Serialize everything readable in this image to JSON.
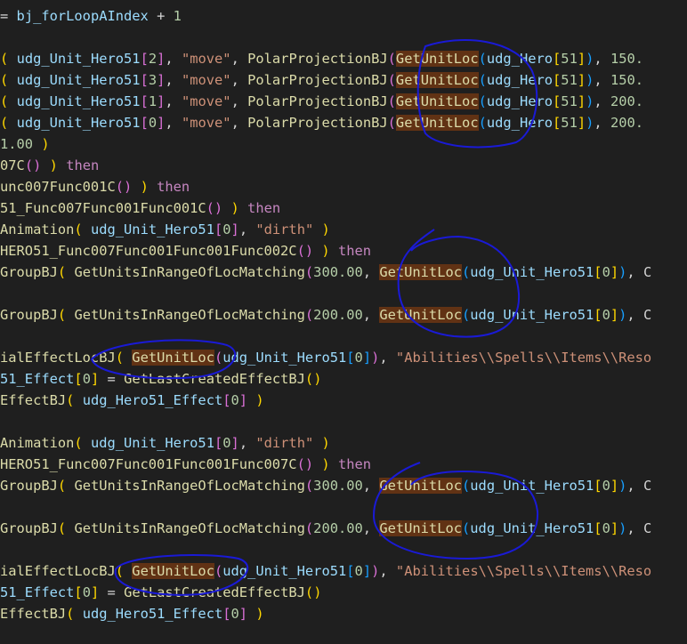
{
  "editor": {
    "colors": {
      "background": "#1f1f1f",
      "function": "#dcdcaa",
      "variable": "#9cdcfe",
      "string": "#ce9178",
      "number": "#b5cea8",
      "keyword": "#c586c0",
      "bracket_gold": "#ffd700",
      "bracket_orchid": "#da70d6",
      "bracket_blue": "#179fff",
      "highlight": "#613214",
      "annotation_ink": "#1a1ad6"
    },
    "lines": [
      [
        [
          "op",
          "= "
        ],
        [
          "var",
          "bj_forLoopAIndex"
        ],
        [
          "op",
          " + "
        ],
        [
          "num",
          "1"
        ]
      ],
      [],
      [
        [
          "br1",
          "("
        ],
        [
          "op",
          " "
        ],
        [
          "var",
          "udg_Unit_Hero51"
        ],
        [
          "br2",
          "["
        ],
        [
          "num",
          "2"
        ],
        [
          "br2",
          "]"
        ],
        [
          "op",
          ", "
        ],
        [
          "str",
          "\"move\""
        ],
        [
          "op",
          ", "
        ],
        [
          "fn",
          "PolarProjectionBJ"
        ],
        [
          "br2",
          "("
        ],
        [
          "fn",
          "GetUnitLoc",
          "hl"
        ],
        [
          "br3",
          "("
        ],
        [
          "var",
          "udg_Hero"
        ],
        [
          "br1",
          "["
        ],
        [
          "num",
          "51"
        ],
        [
          "br1",
          "]"
        ],
        [
          "br3",
          ")"
        ],
        [
          "op",
          ", "
        ],
        [
          "num",
          "150."
        ]
      ],
      [
        [
          "br1",
          "("
        ],
        [
          "op",
          " "
        ],
        [
          "var",
          "udg_Unit_Hero51"
        ],
        [
          "br2",
          "["
        ],
        [
          "num",
          "3"
        ],
        [
          "br2",
          "]"
        ],
        [
          "op",
          ", "
        ],
        [
          "str",
          "\"move\""
        ],
        [
          "op",
          ", "
        ],
        [
          "fn",
          "PolarProjectionBJ"
        ],
        [
          "br2",
          "("
        ],
        [
          "fn",
          "GetUnitLoc",
          "hl"
        ],
        [
          "br3",
          "("
        ],
        [
          "var",
          "udg_Hero"
        ],
        [
          "br1",
          "["
        ],
        [
          "num",
          "51"
        ],
        [
          "br1",
          "]"
        ],
        [
          "br3",
          ")"
        ],
        [
          "op",
          ", "
        ],
        [
          "num",
          "150."
        ]
      ],
      [
        [
          "br1",
          "("
        ],
        [
          "op",
          " "
        ],
        [
          "var",
          "udg_Unit_Hero51"
        ],
        [
          "br2",
          "["
        ],
        [
          "num",
          "1"
        ],
        [
          "br2",
          "]"
        ],
        [
          "op",
          ", "
        ],
        [
          "str",
          "\"move\""
        ],
        [
          "op",
          ", "
        ],
        [
          "fn",
          "PolarProjectionBJ"
        ],
        [
          "br2",
          "("
        ],
        [
          "fn",
          "GetUnitLoc",
          "hl"
        ],
        [
          "br3",
          "("
        ],
        [
          "var",
          "udg_Hero"
        ],
        [
          "br1",
          "["
        ],
        [
          "num",
          "51"
        ],
        [
          "br1",
          "]"
        ],
        [
          "br3",
          ")"
        ],
        [
          "op",
          ", "
        ],
        [
          "num",
          "200."
        ]
      ],
      [
        [
          "br1",
          "("
        ],
        [
          "op",
          " "
        ],
        [
          "var",
          "udg_Unit_Hero51"
        ],
        [
          "br2",
          "["
        ],
        [
          "num",
          "0"
        ],
        [
          "br2",
          "]"
        ],
        [
          "op",
          ", "
        ],
        [
          "str",
          "\"move\""
        ],
        [
          "op",
          ", "
        ],
        [
          "fn",
          "PolarProjectionBJ"
        ],
        [
          "br2",
          "("
        ],
        [
          "fn",
          "GetUnitLoc",
          "hl"
        ],
        [
          "br3",
          "("
        ],
        [
          "var",
          "udg_Hero"
        ],
        [
          "br1",
          "["
        ],
        [
          "num",
          "51"
        ],
        [
          "br1",
          "]"
        ],
        [
          "br3",
          ")"
        ],
        [
          "op",
          ", "
        ],
        [
          "num",
          "200."
        ]
      ],
      [
        [
          "num",
          "1.00"
        ],
        [
          "op",
          " "
        ],
        [
          "br1",
          ")"
        ]
      ],
      [
        [
          "fn",
          "07C"
        ],
        [
          "br2",
          "()"
        ],
        [
          "op",
          " "
        ],
        [
          "br1",
          ")"
        ],
        [
          "op",
          " "
        ],
        [
          "kw",
          "then"
        ]
      ],
      [
        [
          "fn",
          "unc007Func001C"
        ],
        [
          "br2",
          "()"
        ],
        [
          "op",
          " "
        ],
        [
          "br1",
          ")"
        ],
        [
          "op",
          " "
        ],
        [
          "kw",
          "then"
        ]
      ],
      [
        [
          "fn",
          "51_Func007Func001Func001C"
        ],
        [
          "br2",
          "()"
        ],
        [
          "op",
          " "
        ],
        [
          "br1",
          ")"
        ],
        [
          "op",
          " "
        ],
        [
          "kw",
          "then"
        ]
      ],
      [
        [
          "fn",
          "Animation"
        ],
        [
          "br1",
          "("
        ],
        [
          "op",
          " "
        ],
        [
          "var",
          "udg_Unit_Hero51"
        ],
        [
          "br2",
          "["
        ],
        [
          "num",
          "0"
        ],
        [
          "br2",
          "]"
        ],
        [
          "op",
          ", "
        ],
        [
          "str",
          "\"dirth\""
        ],
        [
          "op",
          " "
        ],
        [
          "br1",
          ")"
        ]
      ],
      [
        [
          "fn",
          "HERO51_Func007Func001Func001Func002C"
        ],
        [
          "br2",
          "()"
        ],
        [
          "op",
          " "
        ],
        [
          "br1",
          ")"
        ],
        [
          "op",
          " "
        ],
        [
          "kw",
          "then"
        ]
      ],
      [
        [
          "fn",
          "GroupBJ"
        ],
        [
          "br1",
          "("
        ],
        [
          "op",
          " "
        ],
        [
          "fn",
          "GetUnitsInRangeOfLocMatching"
        ],
        [
          "br2",
          "("
        ],
        [
          "num",
          "300.00"
        ],
        [
          "op",
          ", "
        ],
        [
          "fn",
          "GetUnitLoc",
          "hl"
        ],
        [
          "br3",
          "("
        ],
        [
          "var",
          "udg_Unit_Hero51"
        ],
        [
          "br1",
          "["
        ],
        [
          "num",
          "0"
        ],
        [
          "br1",
          "]"
        ],
        [
          "br3",
          ")"
        ],
        [
          "op",
          ", C"
        ]
      ],
      [],
      [
        [
          "fn",
          "GroupBJ"
        ],
        [
          "br1",
          "("
        ],
        [
          "op",
          " "
        ],
        [
          "fn",
          "GetUnitsInRangeOfLocMatching"
        ],
        [
          "br2",
          "("
        ],
        [
          "num",
          "200.00"
        ],
        [
          "op",
          ", "
        ],
        [
          "fn",
          "GetUnitLoc",
          "hl"
        ],
        [
          "br3",
          "("
        ],
        [
          "var",
          "udg_Unit_Hero51"
        ],
        [
          "br1",
          "["
        ],
        [
          "num",
          "0"
        ],
        [
          "br1",
          "]"
        ],
        [
          "br3",
          ")"
        ],
        [
          "op",
          ", C"
        ]
      ],
      [],
      [
        [
          "fn",
          "ialEffectLocBJ"
        ],
        [
          "br1",
          "("
        ],
        [
          "op",
          " "
        ],
        [
          "fn",
          "GetUnitLoc",
          "hl"
        ],
        [
          "br2",
          "("
        ],
        [
          "var",
          "udg_Unit_Hero51"
        ],
        [
          "br3",
          "["
        ],
        [
          "num",
          "0"
        ],
        [
          "br3",
          "]"
        ],
        [
          "br2",
          ")"
        ],
        [
          "op",
          ", "
        ],
        [
          "str",
          "\"Abilities\\\\Spells\\\\Items\\\\Reso"
        ]
      ],
      [
        [
          "var",
          "51_Effect"
        ],
        [
          "br1",
          "["
        ],
        [
          "num",
          "0"
        ],
        [
          "br1",
          "]"
        ],
        [
          "op",
          " = "
        ],
        [
          "fn",
          "GetLastCreatedEffectBJ"
        ],
        [
          "br1",
          "()"
        ]
      ],
      [
        [
          "fn",
          "EffectBJ"
        ],
        [
          "br1",
          "("
        ],
        [
          "op",
          " "
        ],
        [
          "var",
          "udg_Hero51_Effect"
        ],
        [
          "br2",
          "["
        ],
        [
          "num",
          "0"
        ],
        [
          "br2",
          "]"
        ],
        [
          "op",
          " "
        ],
        [
          "br1",
          ")"
        ]
      ],
      [],
      [
        [
          "fn",
          "Animation"
        ],
        [
          "br1",
          "("
        ],
        [
          "op",
          " "
        ],
        [
          "var",
          "udg_Unit_Hero51"
        ],
        [
          "br2",
          "["
        ],
        [
          "num",
          "0"
        ],
        [
          "br2",
          "]"
        ],
        [
          "op",
          ", "
        ],
        [
          "str",
          "\"dirth\""
        ],
        [
          "op",
          " "
        ],
        [
          "br1",
          ")"
        ]
      ],
      [
        [
          "fn",
          "HERO51_Func007Func001Func001Func007C"
        ],
        [
          "br2",
          "()"
        ],
        [
          "op",
          " "
        ],
        [
          "br1",
          ")"
        ],
        [
          "op",
          " "
        ],
        [
          "kw",
          "then"
        ]
      ],
      [
        [
          "fn",
          "GroupBJ"
        ],
        [
          "br1",
          "("
        ],
        [
          "op",
          " "
        ],
        [
          "fn",
          "GetUnitsInRangeOfLocMatching"
        ],
        [
          "br2",
          "("
        ],
        [
          "num",
          "300.00"
        ],
        [
          "op",
          ", "
        ],
        [
          "fn",
          "GetUnitLoc",
          "hl"
        ],
        [
          "br3",
          "("
        ],
        [
          "var",
          "udg_Unit_Hero51"
        ],
        [
          "br1",
          "["
        ],
        [
          "num",
          "0"
        ],
        [
          "br1",
          "]"
        ],
        [
          "br3",
          ")"
        ],
        [
          "op",
          ", C"
        ]
      ],
      [],
      [
        [
          "fn",
          "GroupBJ"
        ],
        [
          "br1",
          "("
        ],
        [
          "op",
          " "
        ],
        [
          "fn",
          "GetUnitsInRangeOfLocMatching"
        ],
        [
          "br2",
          "("
        ],
        [
          "num",
          "200.00"
        ],
        [
          "op",
          ", "
        ],
        [
          "fn",
          "GetUnitLoc",
          "hl"
        ],
        [
          "br3",
          "("
        ],
        [
          "var",
          "udg_Unit_Hero51"
        ],
        [
          "br1",
          "["
        ],
        [
          "num",
          "0"
        ],
        [
          "br1",
          "]"
        ],
        [
          "br3",
          ")"
        ],
        [
          "op",
          ", C"
        ]
      ],
      [],
      [
        [
          "fn",
          "ialEffectLocBJ"
        ],
        [
          "br1",
          "("
        ],
        [
          "op",
          " "
        ],
        [
          "fn",
          "GetUnitLoc",
          "hl"
        ],
        [
          "br2",
          "("
        ],
        [
          "var",
          "udg_Unit_Hero51"
        ],
        [
          "br3",
          "["
        ],
        [
          "num",
          "0"
        ],
        [
          "br3",
          "]"
        ],
        [
          "br2",
          ")"
        ],
        [
          "op",
          ", "
        ],
        [
          "str",
          "\"Abilities\\\\Spells\\\\Items\\\\Reso"
        ]
      ],
      [
        [
          "var",
          "51_Effect"
        ],
        [
          "br1",
          "["
        ],
        [
          "num",
          "0"
        ],
        [
          "br1",
          "]"
        ],
        [
          "op",
          " = "
        ],
        [
          "fn",
          "GetLastCreatedEffectBJ"
        ],
        [
          "br1",
          "()"
        ]
      ],
      [
        [
          "fn",
          "EffectBJ"
        ],
        [
          "br1",
          "("
        ],
        [
          "op",
          " "
        ],
        [
          "var",
          "udg_Hero51_Effect"
        ],
        [
          "br2",
          "["
        ],
        [
          "num",
          "0"
        ],
        [
          "br2",
          "]"
        ],
        [
          "op",
          " "
        ],
        [
          "br1",
          ")"
        ]
      ]
    ]
  }
}
